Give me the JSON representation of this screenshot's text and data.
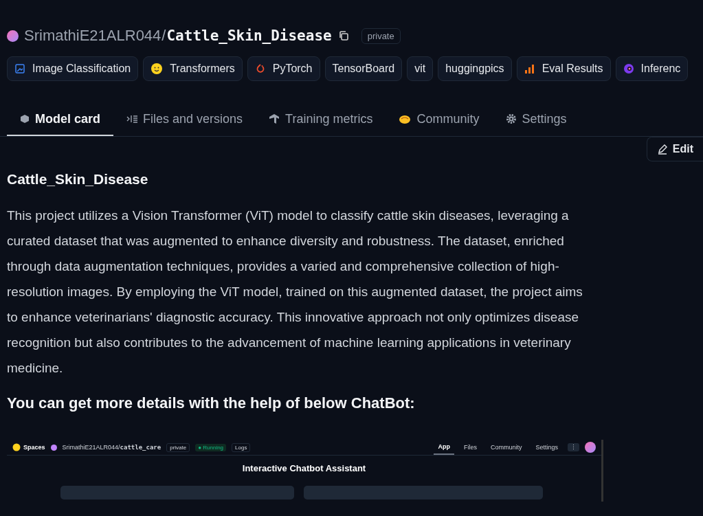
{
  "repo": {
    "owner": "SrimathiE21ALR044",
    "separator": "/",
    "name": "Cattle_Skin_Disease",
    "visibility": "private"
  },
  "tags": [
    {
      "label": "Image Classification",
      "kind": "task"
    },
    {
      "label": "Transformers",
      "kind": "hf"
    },
    {
      "label": "PyTorch",
      "kind": "torch"
    },
    {
      "label": "TensorBoard",
      "kind": "plain"
    },
    {
      "label": "vit",
      "kind": "plain"
    },
    {
      "label": "huggingpics",
      "kind": "plain"
    },
    {
      "label": "Eval Results",
      "kind": "eval"
    },
    {
      "label": "Inferenc",
      "kind": "inference"
    }
  ],
  "tabs": [
    {
      "label": "Model card",
      "kind": "card",
      "selected": true
    },
    {
      "label": "Files and versions",
      "kind": "files",
      "selected": false
    },
    {
      "label": "Training metrics",
      "kind": "metrics",
      "selected": false
    },
    {
      "label": "Community",
      "kind": "community",
      "selected": false
    },
    {
      "label": "Settings",
      "kind": "settings",
      "selected": false
    }
  ],
  "edit_button": "Edit",
  "heading": "Cattle_Skin_Disease",
  "description": "This project utilizes a Vision Transformer (ViT) model to classify cattle skin diseases, leveraging a curated dataset that was augmented to enhance diversity and robustness. The dataset, enriched through data augmentation techniques, provides a varied and comprehensive collection of high-resolution images. By employing the ViT model, trained on this augmented dataset, the project aims to enhance veterinarians' diagnostic accuracy. This innovative approach not only optimizes disease recognition but also contributes to the advancement of machine learning applications in veterinary medicine.",
  "subheading": "You can get more details with the help of below ChatBot:",
  "embedded_screenshot": {
    "brand": "Spaces",
    "owner": "SrimathiE21ALR044",
    "separator": "/",
    "name": "cattle_care",
    "visibility": "private",
    "status_dot": "●",
    "status": "Running",
    "logs": "Logs",
    "tabs": [
      {
        "label": "App",
        "selected": true
      },
      {
        "label": "Files",
        "selected": false
      },
      {
        "label": "Community",
        "selected": false
      },
      {
        "label": "Settings",
        "selected": false
      }
    ],
    "more": "⋮",
    "title": "Interactive Chatbot Assistant"
  }
}
